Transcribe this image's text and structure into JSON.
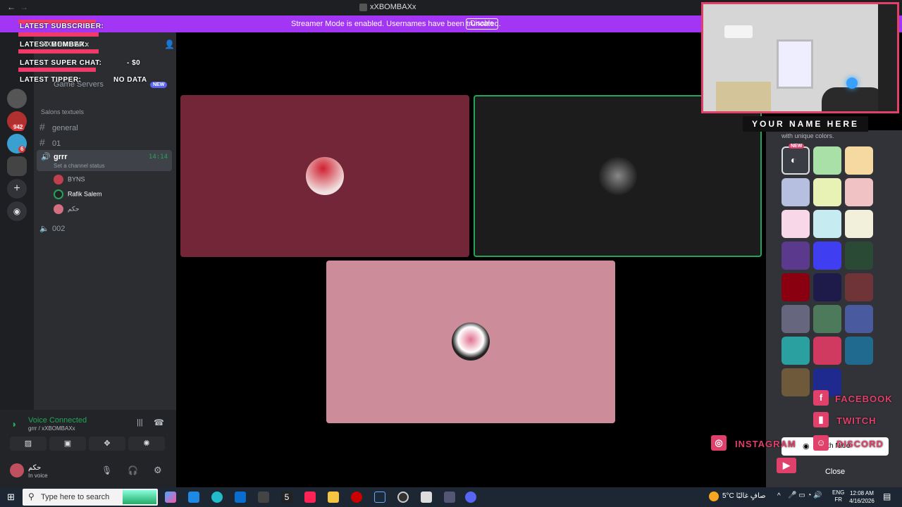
{
  "window": {
    "title": "xXBOMBAXx",
    "back": "←",
    "forward": "→"
  },
  "banner": {
    "text": "Streamer Mode is enabled. Usernames have been truncated.",
    "button": "Disable"
  },
  "rail": {
    "badges": [
      "942",
      "6"
    ]
  },
  "sidebar": {
    "game_servers": {
      "label": "Game Servers",
      "badge": "NEW"
    },
    "category": "Salons textuels",
    "channels": [
      {
        "name": "general",
        "type": "text"
      },
      {
        "name": "01",
        "type": "text"
      }
    ],
    "voice_channel": {
      "name": "grrr",
      "time": "14:14",
      "status": "Set a channel status",
      "members": [
        "BYNS",
        "Rafik Salem",
        "حكم"
      ]
    },
    "voice_channel_2": {
      "name": "002"
    }
  },
  "voice_panel": {
    "title": "Voice Connected",
    "subtitle": "grrr / xXBOMBAXx",
    "user_name": "حكم",
    "user_status": "In voice"
  },
  "overlay": {
    "latest_subscriber": "LATEST SUBSCRIBER:",
    "latest_member": "LATEST MEMBER:",
    "latest_superchat": "LATEST SUPER CHAT:",
    "superchat_value": "- $0",
    "latest_tipper": "LATEST TIPPER:",
    "tipper_value": "NO DATA",
    "server_name": "xXBOMBAXx"
  },
  "webcam": {
    "name_plate": "YOUR NAME HERE"
  },
  "theme_panel": {
    "subtitle": "with unique colors.",
    "new_badge": "NEW",
    "nitro_button": "k with Nitro",
    "close_button": "Close",
    "swatches": [
      [
        "#3a3d44",
        "#a8e0a8",
        "#f5d9a0"
      ],
      [
        "#b6bfe0",
        "#e8f2b5",
        "#f0c2c4"
      ],
      [
        "#f8d7e8",
        "#c6ecf2",
        "#f2f0da"
      ],
      [
        "#5b3a8e",
        "#3f3ef0",
        "#2a4a36"
      ],
      [
        "#8b0010",
        "#1e1b4a",
        "#6e3438"
      ],
      [
        "#66667e",
        "#4e7a5c",
        "#4a5a9e"
      ],
      [
        "#2ba0a0",
        "#d03a60",
        "#1f6a8e"
      ],
      [
        "#6e5a3a",
        "#1f2a8e",
        null
      ]
    ]
  },
  "socials": {
    "facebook": "FACEBOOK",
    "twitch": "TWITCH",
    "instagram": "INSTAGRAM",
    "discord": "DISCORD"
  },
  "taskbar": {
    "search_placeholder": "Type here to search",
    "weather": "5°C  صافٍ غالبًا",
    "lang_top": "ENG",
    "lang_bottom": "FR",
    "time": "12:08 AM",
    "date": "4/16/2026"
  },
  "colors": {
    "tile_1": "#732638",
    "tile_2": "#1c1c1c",
    "tile_3": "#cd8c99",
    "accent": "#a335f5",
    "overlay_pink": "#e0406a"
  }
}
